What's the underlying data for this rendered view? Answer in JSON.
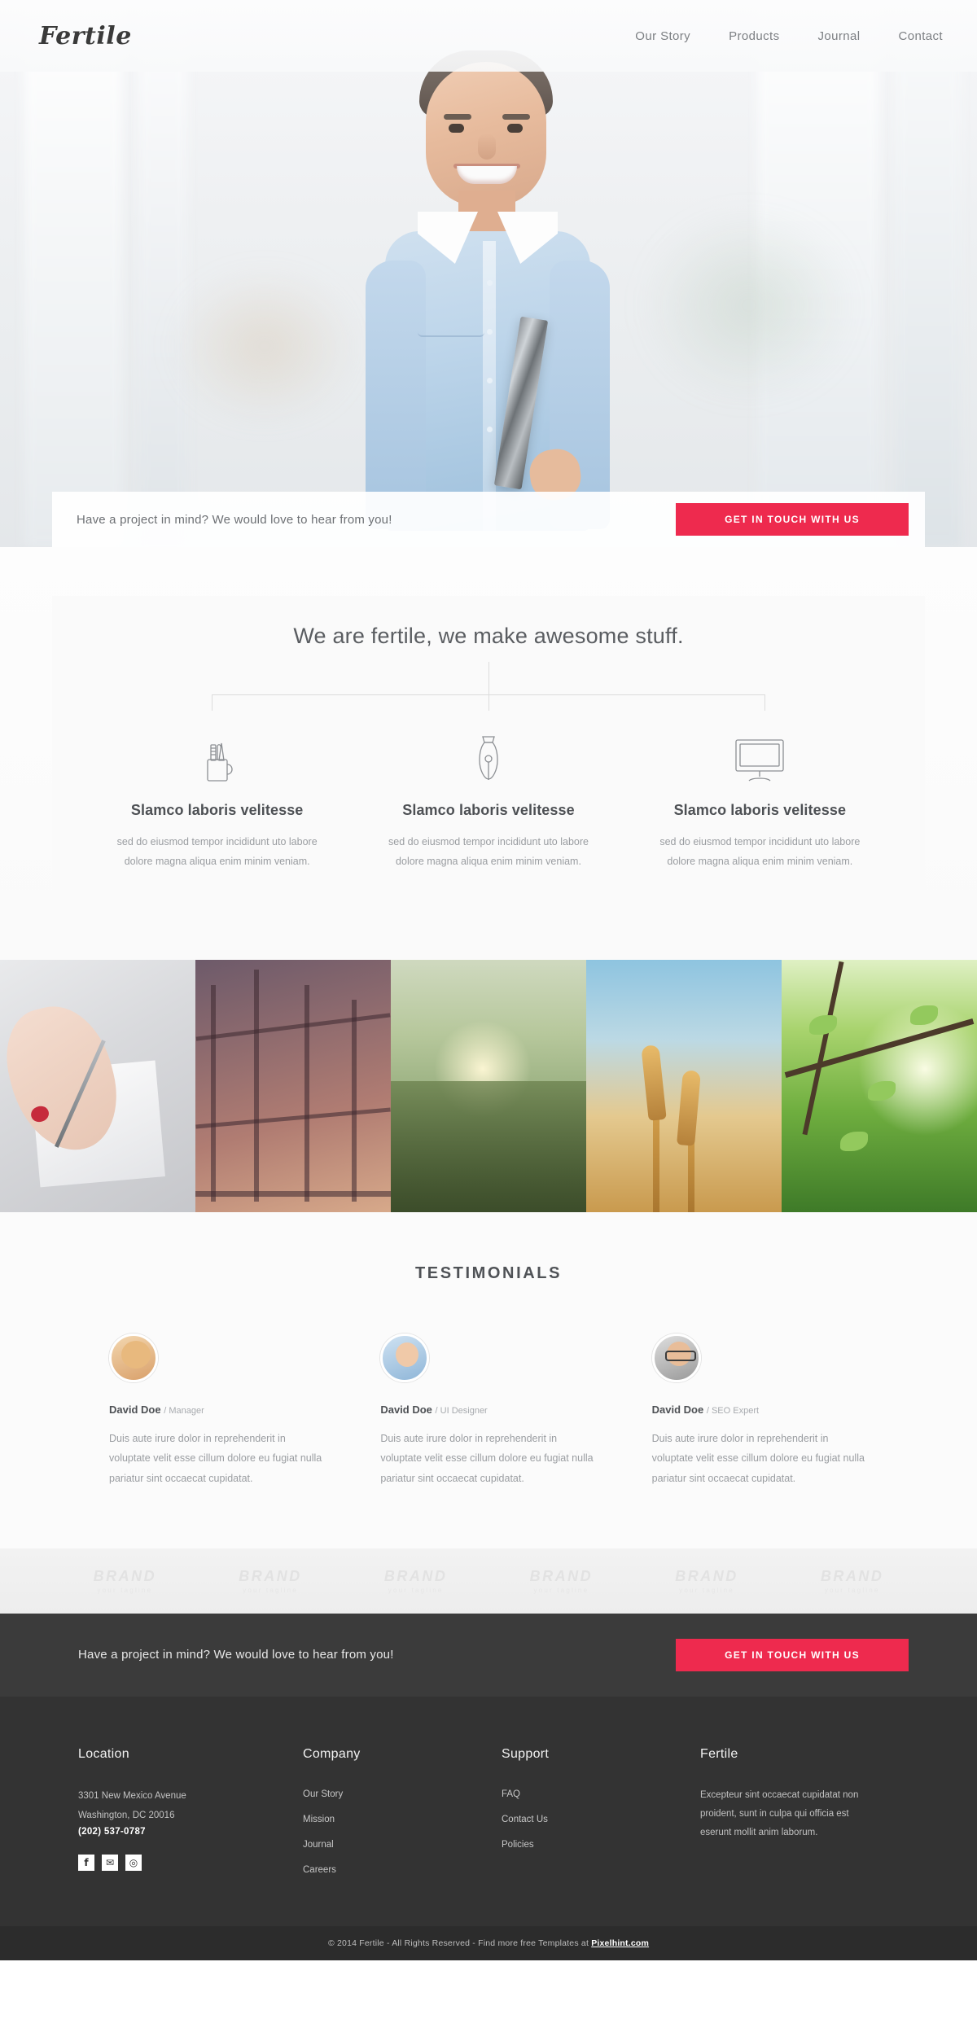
{
  "header": {
    "logo": "Fertile",
    "nav": [
      {
        "label": "Our Story"
      },
      {
        "label": "Products"
      },
      {
        "label": "Journal"
      },
      {
        "label": "Contact"
      }
    ]
  },
  "hero_cta": {
    "text": "Have a project in mind? We would love to hear from you!",
    "button": "GET IN TOUCH WITH US"
  },
  "features": {
    "title": "We are fertile, we make awesome stuff.",
    "items": [
      {
        "icon": "pencil-cup-icon",
        "heading": "Slamco laboris velitesse",
        "body": "sed do eiusmod tempor incididunt uto labore dolore magna aliqua enim minim veniam."
      },
      {
        "icon": "fountain-pen-nib-icon",
        "heading": "Slamco laboris velitesse",
        "body": "sed do eiusmod tempor incididunt uto labore dolore magna aliqua enim minim veniam."
      },
      {
        "icon": "monitor-icon",
        "heading": "Slamco laboris velitesse",
        "body": "sed do eiusmod tempor incididunt uto labore dolore magna aliqua enim minim veniam."
      }
    ]
  },
  "gallery": [
    {
      "alt": "hand-writing-with-pen-photo"
    },
    {
      "alt": "steel-bridge-truss-photo"
    },
    {
      "alt": "grass-field-sunset-photo"
    },
    {
      "alt": "wheat-ears-sky-photo"
    },
    {
      "alt": "sunlit-green-leaves-photo"
    }
  ],
  "testimonials": {
    "title": "TESTIMONIALS",
    "items": [
      {
        "avatar": "avatar-woman",
        "name": "David Doe",
        "role": "/ Manager",
        "quote": "Duis aute irure dolor in reprehenderit in voluptate velit esse cillum dolore eu fugiat nulla pariatur sint occaecat cupidatat."
      },
      {
        "avatar": "avatar-man-blue-shirt",
        "name": "David Doe",
        "role": "/ UI Designer",
        "quote": "Duis aute irure dolor in reprehenderit in voluptate velit esse cillum dolore eu fugiat nulla pariatur sint occaecat cupidatat."
      },
      {
        "avatar": "avatar-man-glasses",
        "name": "David Doe",
        "role": "/ SEO Expert",
        "quote": "Duis aute irure dolor in reprehenderit in voluptate velit esse cillum dolore eu fugiat nulla pariatur sint occaecat cupidatat."
      }
    ]
  },
  "brands": [
    {
      "name": "BRAND",
      "tagline": "your tagline"
    },
    {
      "name": "BRAND",
      "tagline": "your tagline"
    },
    {
      "name": "BRAND",
      "tagline": "your tagline"
    },
    {
      "name": "BRAND",
      "tagline": "your tagline"
    },
    {
      "name": "BRAND",
      "tagline": "your tagline"
    },
    {
      "name": "BRAND",
      "tagline": "your tagline"
    }
  ],
  "dark_cta": {
    "text": "Have a project in mind? We would love to hear from you!",
    "button": "GET IN TOUCH WITH US"
  },
  "footer": {
    "location": {
      "title": "Location",
      "line1": "3301 New Mexico Avenue",
      "line2": "Washington, DC 20016",
      "phone": "(202) 537-0787",
      "socials": [
        {
          "name": "facebook-icon",
          "glyph": "f"
        },
        {
          "name": "twitter-icon",
          "glyph": "✉"
        },
        {
          "name": "dribbble-icon",
          "glyph": "◎"
        }
      ]
    },
    "company": {
      "title": "Company",
      "links": [
        {
          "label": "Our Story"
        },
        {
          "label": "Mission"
        },
        {
          "label": "Journal"
        },
        {
          "label": "Careers"
        }
      ]
    },
    "support": {
      "title": "Support",
      "links": [
        {
          "label": "FAQ"
        },
        {
          "label": "Contact Us"
        },
        {
          "label": "Policies"
        }
      ]
    },
    "about": {
      "title": "Fertile",
      "text": "Excepteur sint occaecat cupidatat non proident, sunt in culpa qui officia est eserunt mollit anim laborum."
    }
  },
  "copyright": {
    "prefix": "© 2014 Fertile - All Rights Reserved - Find more free Templates at ",
    "link": "Pixelhint.com"
  },
  "colors": {
    "accent": "#ee2a4e",
    "dark": "#333333",
    "darker": "#2c2c2c"
  }
}
